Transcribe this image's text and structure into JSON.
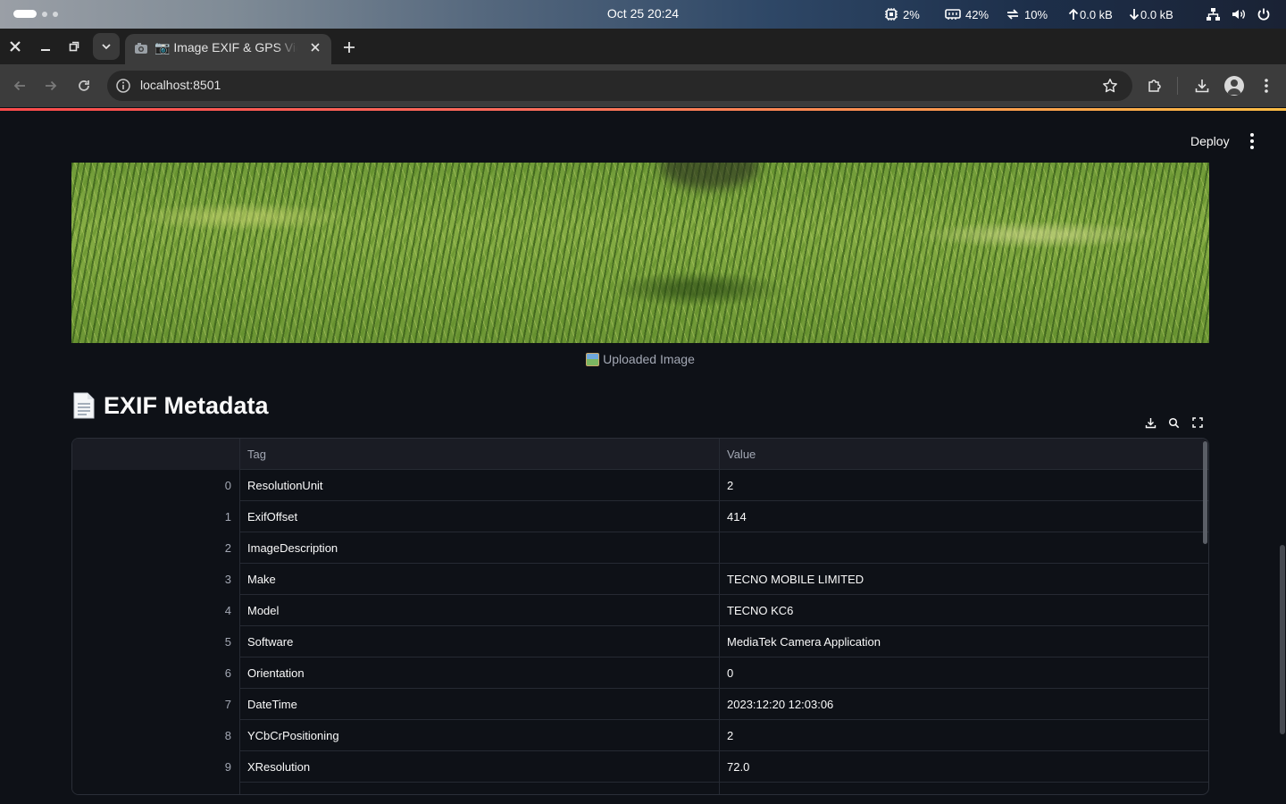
{
  "os": {
    "clock": "Oct 25  20:24",
    "cpu": "2%",
    "ram": "42%",
    "swap": "10%",
    "upload": "0.0 kB",
    "download": "0.0 kB"
  },
  "browser": {
    "tab_title": "📷 Image EXIF & GPS Viewer",
    "url": "localhost:8501"
  },
  "app": {
    "deploy_label": "Deploy",
    "image_caption": "Uploaded Image",
    "section_title": "EXIF Metadata"
  },
  "table": {
    "columns": [
      "",
      "Tag",
      "Value"
    ],
    "rows": [
      {
        "index": "0",
        "tag": "ResolutionUnit",
        "value": "2"
      },
      {
        "index": "1",
        "tag": "ExifOffset",
        "value": "414"
      },
      {
        "index": "2",
        "tag": "ImageDescription",
        "value": ""
      },
      {
        "index": "3",
        "tag": "Make",
        "value": "TECNO MOBILE LIMITED"
      },
      {
        "index": "4",
        "tag": "Model",
        "value": "TECNO KC6"
      },
      {
        "index": "5",
        "tag": "Software",
        "value": "MediaTek Camera Application"
      },
      {
        "index": "6",
        "tag": "Orientation",
        "value": "0"
      },
      {
        "index": "7",
        "tag": "DateTime",
        "value": "2023:12:20 12:03:06"
      },
      {
        "index": "8",
        "tag": "YCbCrPositioning",
        "value": "2"
      },
      {
        "index": "9",
        "tag": "XResolution",
        "value": "72.0"
      }
    ]
  },
  "colors": {
    "app_background": "#0e1117",
    "accent_line_start": "#ff4b4b",
    "accent_line_end": "#ffbd45"
  }
}
